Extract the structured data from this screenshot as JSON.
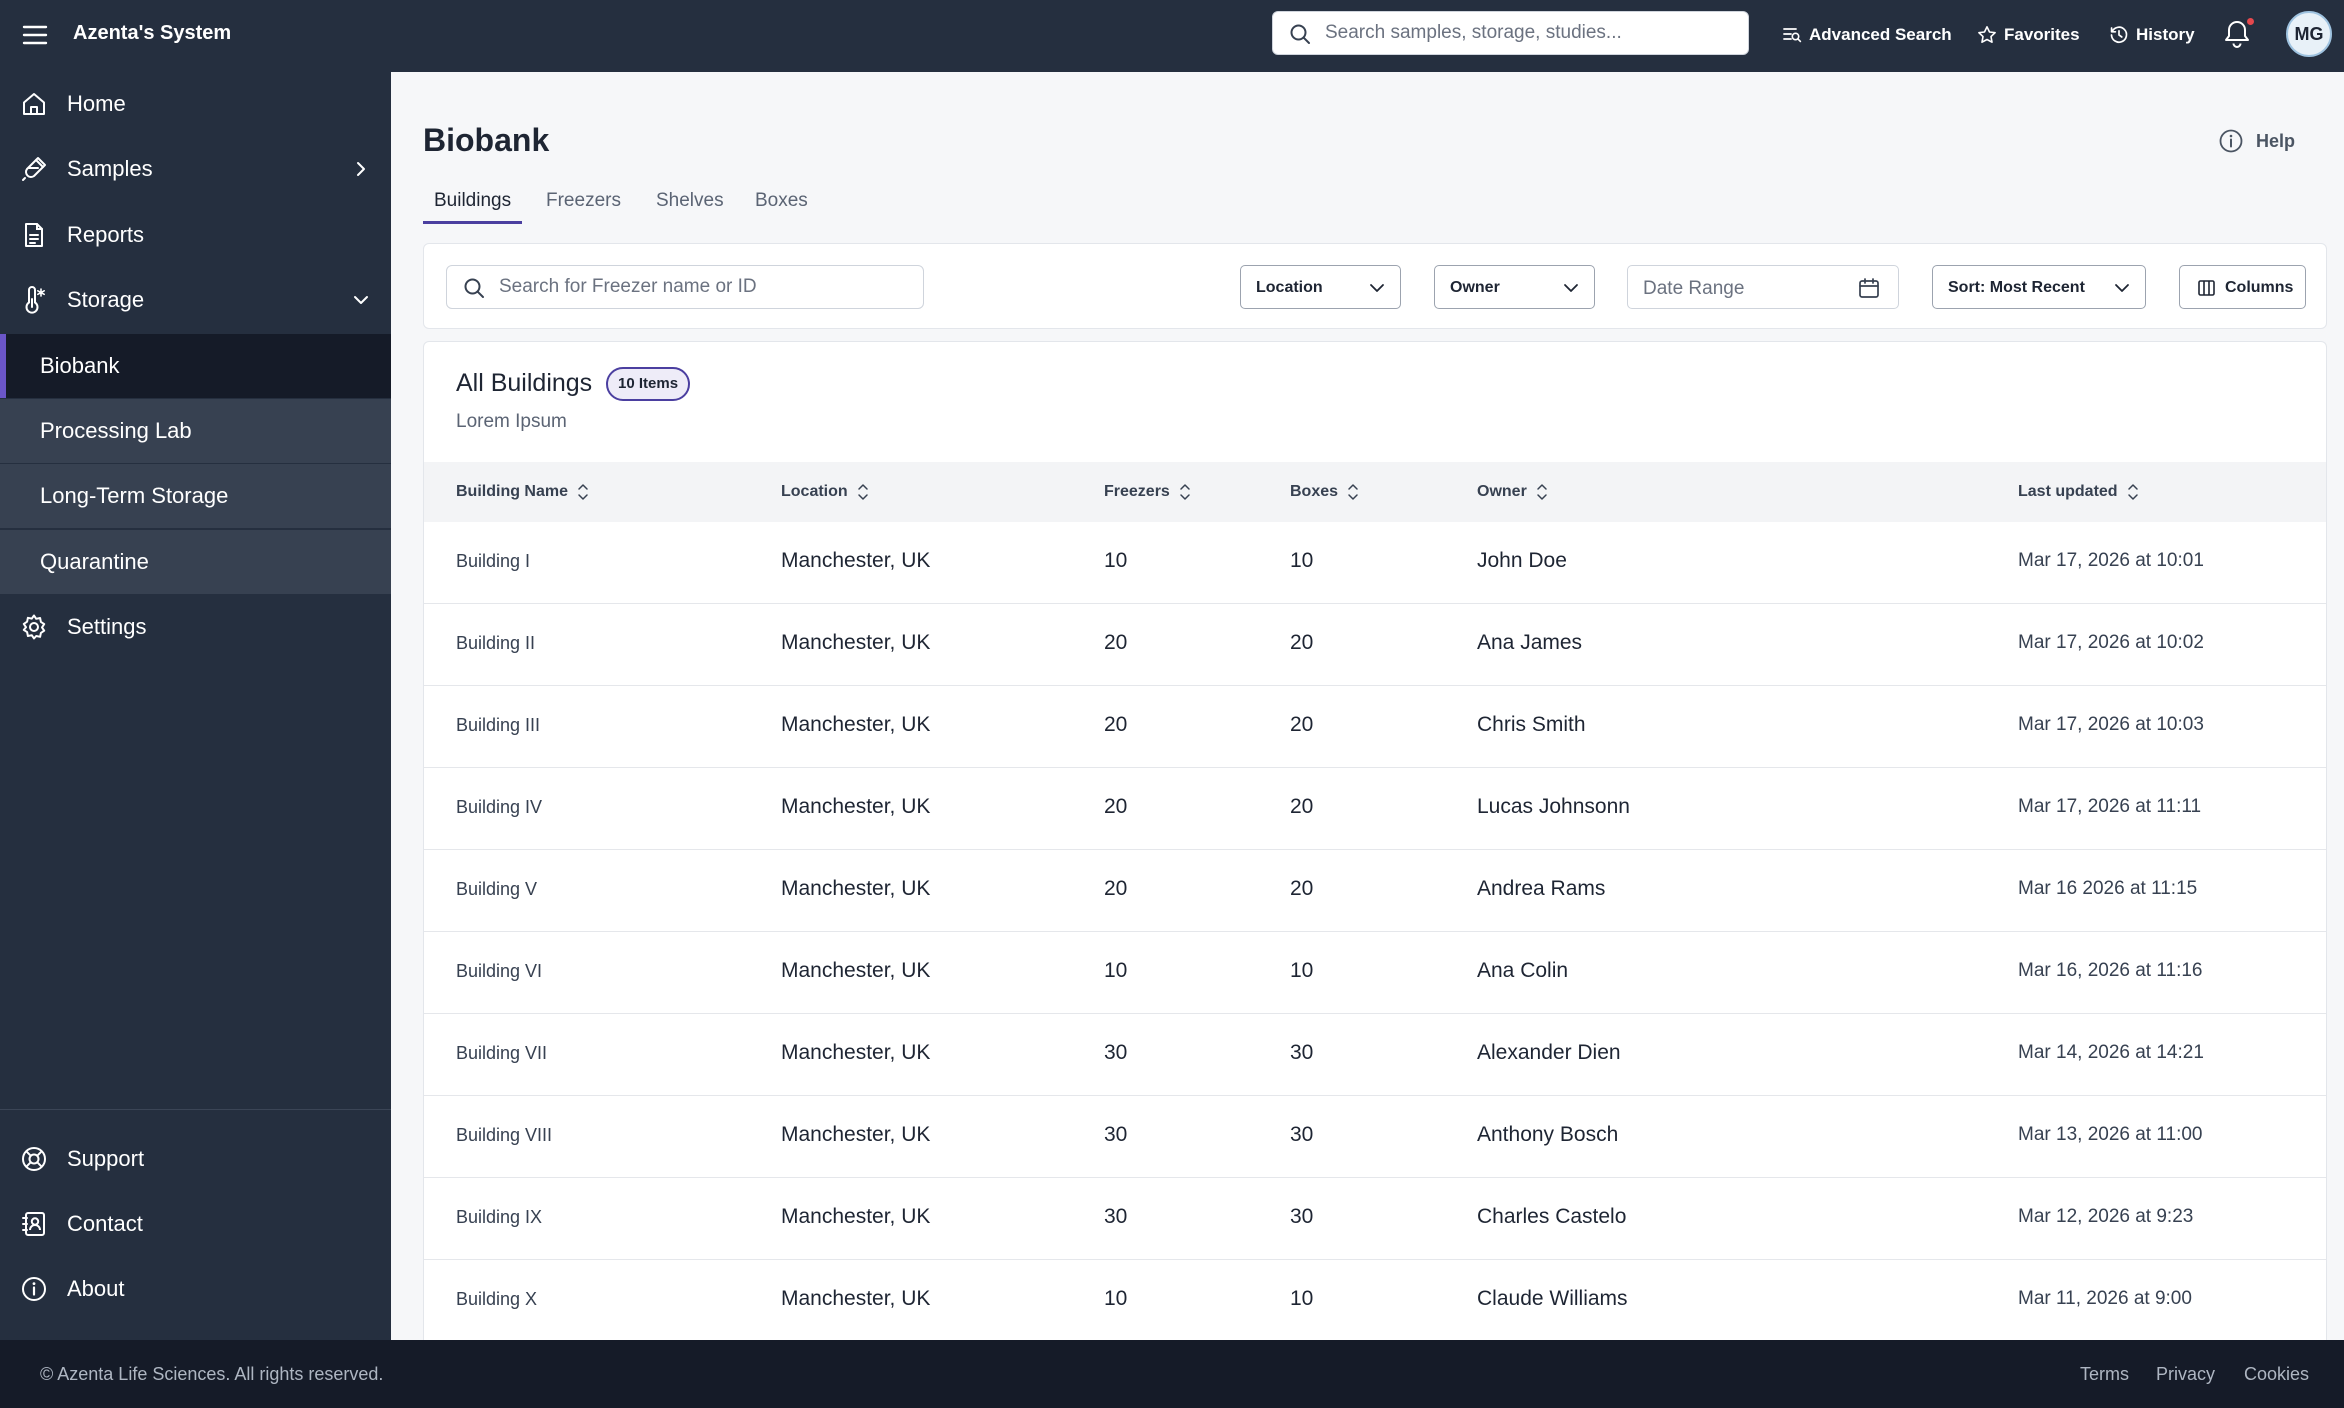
{
  "app": {
    "title": "Azenta's System",
    "search_placeholder": "Search samples, storage, studies...",
    "avatar_initials": "MG"
  },
  "top_actions": {
    "advanced_search": "Advanced Search",
    "favorites": "Favorites",
    "history": "History"
  },
  "sidebar": {
    "items": [
      {
        "label": "Home",
        "icon": "home-icon"
      },
      {
        "label": "Samples",
        "icon": "samples-icon",
        "expandable": true,
        "expanded": false
      },
      {
        "label": "Reports",
        "icon": "reports-icon"
      },
      {
        "label": "Storage",
        "icon": "thermometer-icon",
        "expandable": true,
        "expanded": true
      },
      {
        "label": "Settings",
        "icon": "gear-icon"
      }
    ],
    "storage_subitems": [
      "Biobank",
      "Processing Lab",
      "Long-Term Storage",
      "Quarantine"
    ],
    "active_subitem": "Biobank",
    "bottom_items": [
      {
        "label": "Support",
        "icon": "lifebuoy-icon"
      },
      {
        "label": "Contact",
        "icon": "contact-icon"
      },
      {
        "label": "About",
        "icon": "info-icon"
      }
    ]
  },
  "page": {
    "title": "Biobank",
    "help_label": "Help",
    "tabs": [
      "Buildings",
      "Freezers",
      "Shelves",
      "Boxes"
    ],
    "active_tab": "Buildings",
    "accent_color": "#4b3fa0"
  },
  "filters": {
    "search_placeholder": "Search for Freezer name or ID",
    "location_label": "Location",
    "owner_label": "Owner",
    "date_range_placeholder": "Date Range",
    "sort_label": "Sort: Most Recent",
    "columns_label": "Columns"
  },
  "table": {
    "title": "All Buildings",
    "count_badge": "10 Items",
    "subtitle": "Lorem Ipsum",
    "columns": [
      "Building Name",
      "Location",
      "Freezers",
      "Boxes",
      "Owner",
      "Last updated"
    ],
    "rows": [
      [
        "Building I",
        "Manchester, UK",
        "10",
        "10",
        "John Doe",
        "Mar 17, 2026 at 10:01"
      ],
      [
        "Building II",
        "Manchester, UK",
        "20",
        "20",
        "Ana James",
        "Mar 17, 2026 at 10:02"
      ],
      [
        "Building III",
        "Manchester, UK",
        "20",
        "20",
        "Chris Smith",
        "Mar 17, 2026 at 10:03"
      ],
      [
        "Building IV",
        "Manchester, UK",
        "20",
        "20",
        "Lucas Johnsonn",
        "Mar 17, 2026 at 11:11"
      ],
      [
        "Building V",
        "Manchester, UK",
        "20",
        "20",
        "Andrea Rams",
        "Mar 16 2026 at 11:15"
      ],
      [
        "Building VI",
        "Manchester, UK",
        "10",
        "10",
        "Ana Colin",
        "Mar 16, 2026 at 11:16"
      ],
      [
        "Building VII",
        "Manchester, UK",
        "30",
        "30",
        "Alexander Dien",
        "Mar 14, 2026 at 14:21"
      ],
      [
        "Building VIII",
        "Manchester, UK",
        "30",
        "30",
        "Anthony Bosch",
        "Mar 13, 2026 at 11:00"
      ],
      [
        "Building IX",
        "Manchester, UK",
        "30",
        "30",
        "Charles Castelo",
        "Mar 12, 2026 at 9:23"
      ],
      [
        "Building X",
        "Manchester, UK",
        "10",
        "10",
        "Claude Williams",
        "Mar 11, 2026 at 9:00"
      ]
    ]
  },
  "footer": {
    "copyright": "© Azenta Life Sciences. All rights reserved.",
    "links": [
      "Terms",
      "Privacy",
      "Cookies"
    ]
  },
  "colors": {
    "topbar": "#252f3f",
    "sidebar": "#252f3f",
    "subnav": "#374151",
    "active_nav": "#151b28",
    "active_indicator": "#6b56c8",
    "notification_dot": "#e5484d"
  }
}
